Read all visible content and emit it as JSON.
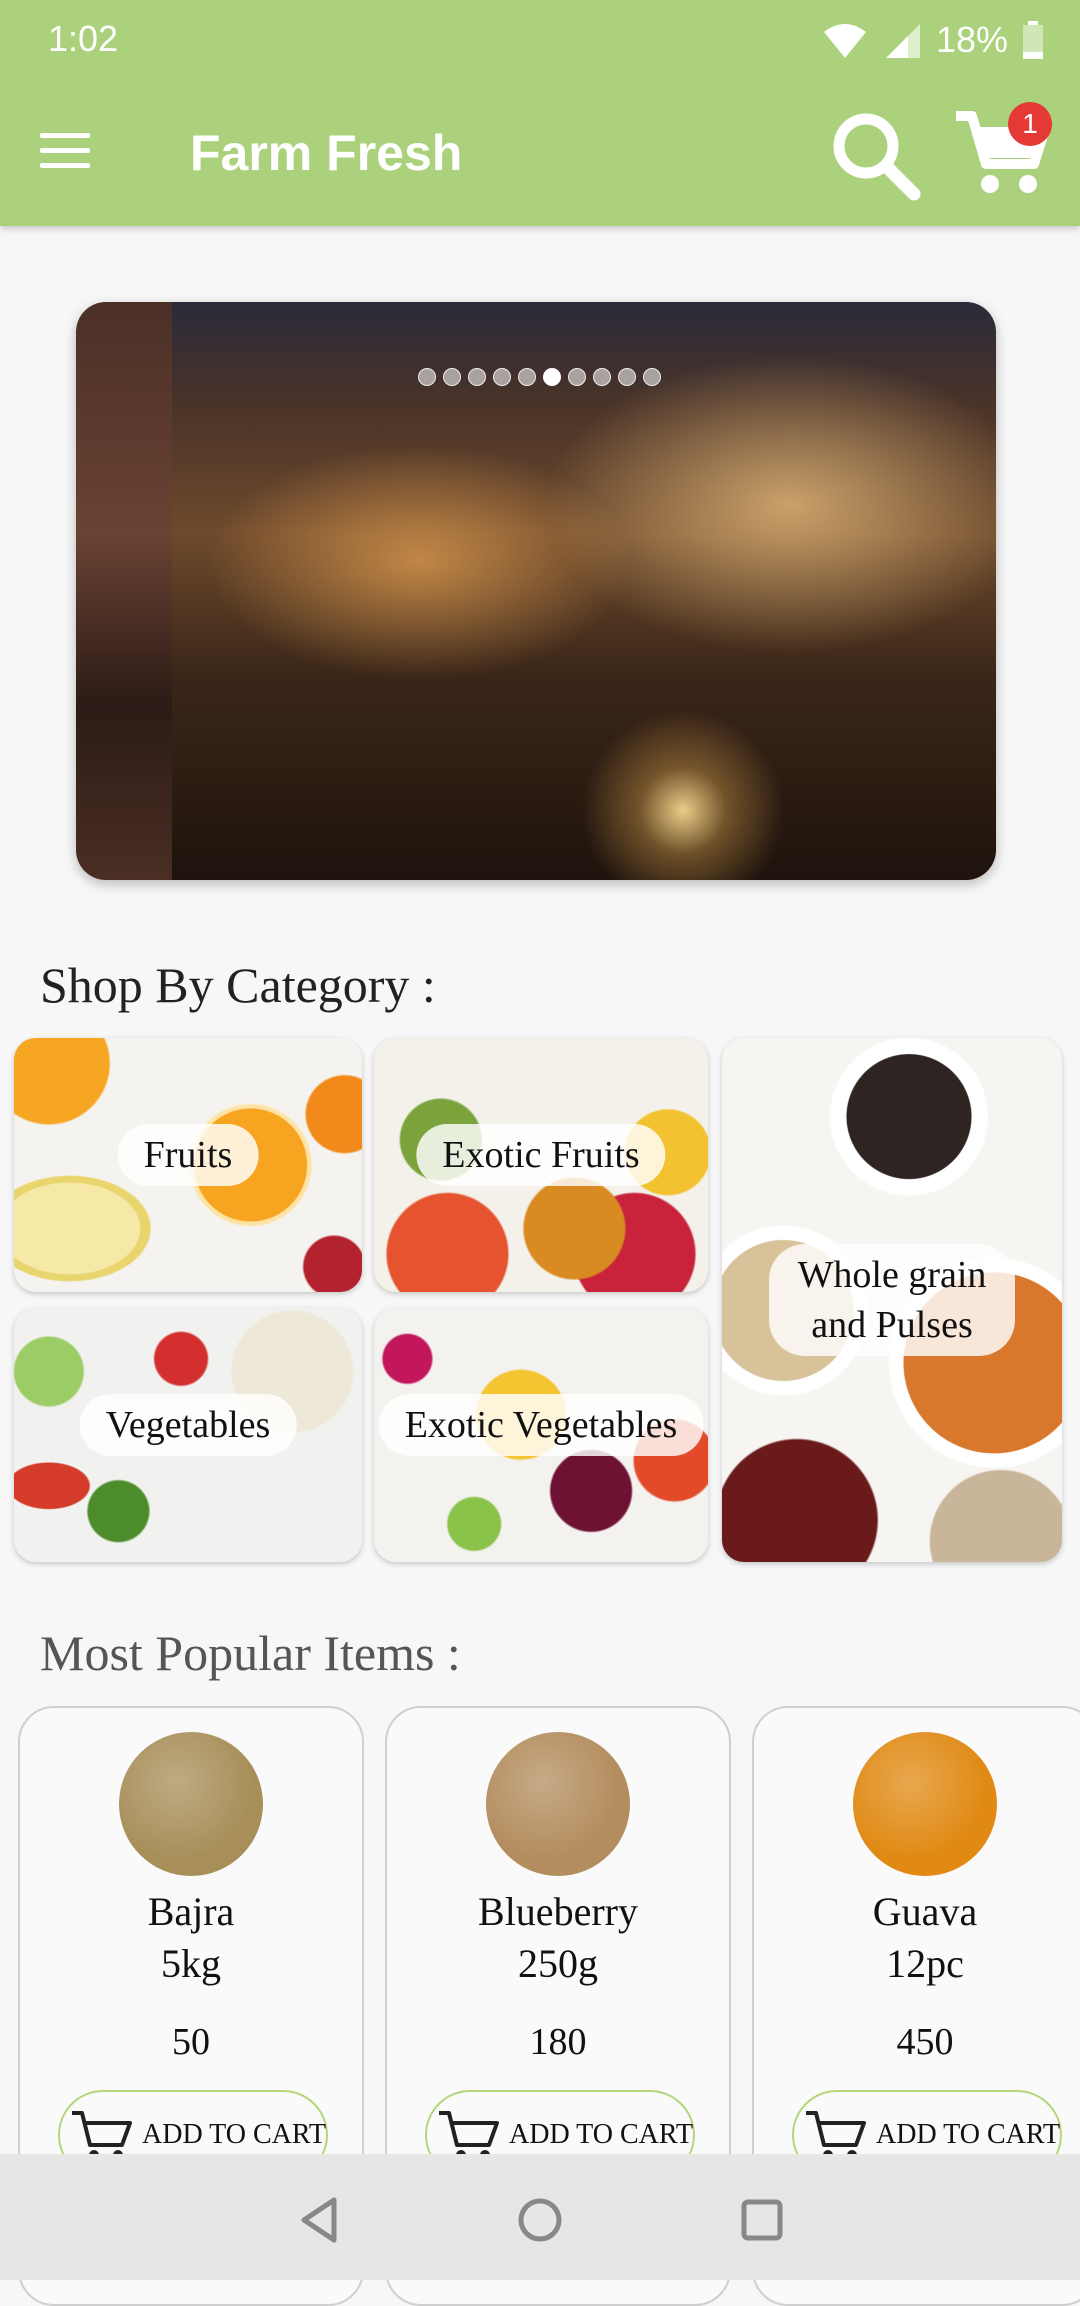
{
  "status_bar": {
    "time": "1:02",
    "battery": "18%"
  },
  "toolbar": {
    "title": "Farm Fresh",
    "cart_count": "1",
    "icons": {
      "menu": "hamburger-menu-icon",
      "search": "search-icon",
      "cart": "cart-icon"
    }
  },
  "banner": {
    "slide_count": 10,
    "active_index": 5
  },
  "categories": {
    "title": "Shop By Category :",
    "items": [
      {
        "label": "Fruits"
      },
      {
        "label": "Exotic Fruits"
      },
      {
        "label": "Whole grain and Pulses"
      },
      {
        "label": "Vegetables"
      },
      {
        "label": "Exotic Vegetables"
      }
    ]
  },
  "popular": {
    "title": "Most Popular Items :",
    "items": [
      {
        "name": "Bajra",
        "qty": "5kg",
        "price": "50",
        "button": "ADD TO CART",
        "color": "#a88f5a"
      },
      {
        "name": "Blueberry",
        "qty": "250g",
        "price": "180",
        "button": "ADD TO CART",
        "color": "#b38d5e"
      },
      {
        "name": "Guava",
        "qty": "12pc",
        "price": "450",
        "button": "ADD TO CART",
        "color": "#e08a14"
      }
    ]
  },
  "colors": {
    "toolbar": "#acd17c",
    "badge": "#e53935",
    "button_border": "#b5d67a"
  },
  "nav": {
    "icons": [
      "back-icon",
      "home-icon",
      "recents-icon"
    ]
  }
}
